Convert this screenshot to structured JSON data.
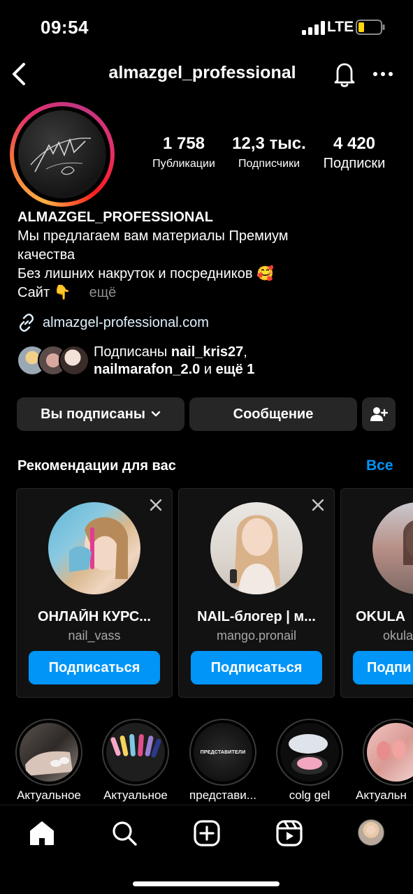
{
  "status_bar": {
    "time": "09:54",
    "network": "LTE"
  },
  "header": {
    "username": "almazgel_professional",
    "icons": [
      "back-icon",
      "bell-icon",
      "more-icon"
    ]
  },
  "profile": {
    "stats": [
      {
        "value": "1 758",
        "label": "Публикации"
      },
      {
        "value": "12,3 тыс.",
        "label": "Подписчики"
      },
      {
        "value": "4 420",
        "label": "Подписки"
      }
    ],
    "name": "ALMAZGEL_PROFESSIONAL",
    "bio_lines": [
      "Мы предлагаем вам материалы Премиум",
      "качества",
      "Без лишних накруток и посредников 🥰",
      "Сайт 👇"
    ],
    "bio_more": "ещё",
    "link": "almazgel-professional.com",
    "followed_by": {
      "prefix": "Подписаны ",
      "user1": "nail_kris27",
      "sep": ",",
      "user2": "nailmarafon_2.0",
      "middle": " и ",
      "rest": "ещё 1"
    }
  },
  "actions": {
    "following": "Вы подписаны",
    "message": "Сообщение"
  },
  "recommendations": {
    "title": "Рекомендации для вас",
    "see_all": "Все",
    "cards": [
      {
        "name": "ОНЛАЙН КУРС...",
        "username": "nail_vass",
        "button": "Подписаться"
      },
      {
        "name": "NAIL-блогер | м...",
        "username": "mango.pronail",
        "button": "Подписаться"
      },
      {
        "name": "OKULA",
        "username": "okula",
        "button": "Подпи"
      }
    ]
  },
  "highlights": [
    {
      "label": "Актуальное"
    },
    {
      "label": "Актуальное"
    },
    {
      "label": "представи...",
      "inner_text": "ПРЕДСТАВИТЕЛИ"
    },
    {
      "label": "colg gel"
    },
    {
      "label": "Актуальн"
    }
  ],
  "nav": [
    "home-icon",
    "search-icon",
    "create-icon",
    "reels-icon",
    "profile-avatar"
  ],
  "colors": {
    "accent": "#0095f6",
    "button_bg": "#262626",
    "muted": "#8e8e8e"
  }
}
